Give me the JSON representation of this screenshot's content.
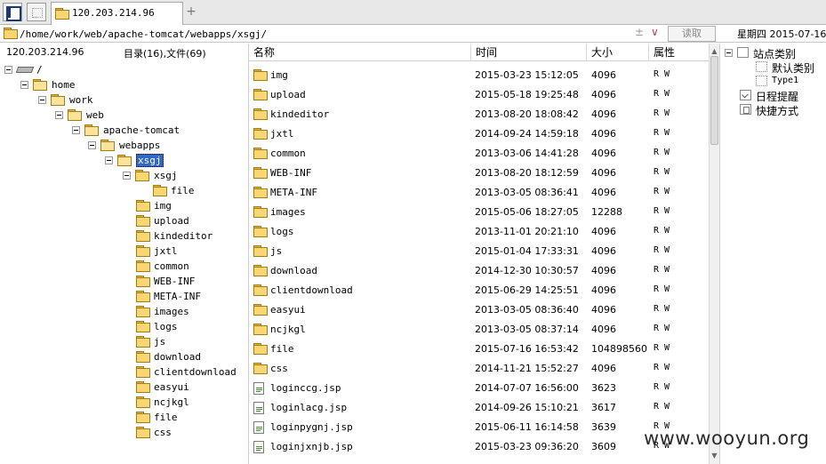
{
  "tab": {
    "title": "120.203.214.96",
    "add_label": "+"
  },
  "address": {
    "path": "/home/work/web/apache-tomcat/webapps/xsgj/",
    "plus_symbol": "±",
    "dropdown_symbol": "∨",
    "read_label": "读取",
    "date_text": "星期四 2015-07-16"
  },
  "left": {
    "ip": "120.203.214.96",
    "count": "目录(16),文件(69)",
    "tree": [
      {
        "label": "/",
        "icon": "drive-icon"
      },
      {
        "label": "home"
      },
      {
        "label": "work"
      },
      {
        "label": "web"
      },
      {
        "label": "apache-tomcat"
      },
      {
        "label": "webapps"
      },
      {
        "label": "xsgj",
        "selected": true
      },
      {
        "label": "xsgj"
      },
      {
        "label": "file"
      },
      {
        "label": "img"
      },
      {
        "label": "upload"
      },
      {
        "label": "kindeditor"
      },
      {
        "label": "jxtl"
      },
      {
        "label": "common"
      },
      {
        "label": "WEB-INF"
      },
      {
        "label": "META-INF"
      },
      {
        "label": "images"
      },
      {
        "label": "logs"
      },
      {
        "label": "js"
      },
      {
        "label": "download"
      },
      {
        "label": "clientdownload"
      },
      {
        "label": "easyui"
      },
      {
        "label": "ncjkgl"
      },
      {
        "label": "file"
      },
      {
        "label": "css"
      }
    ]
  },
  "list": {
    "columns": {
      "name": "名称",
      "time": "时间",
      "size": "大小",
      "attr": "属性"
    },
    "rows": [
      {
        "name": "img",
        "time": "2015-03-23 15:12:05",
        "size": "4096",
        "attr": "R W",
        "type": "folder"
      },
      {
        "name": "upload",
        "time": "2015-05-18 19:25:48",
        "size": "4096",
        "attr": "R W",
        "type": "folder"
      },
      {
        "name": "kindeditor",
        "time": "2013-08-20 18:08:42",
        "size": "4096",
        "attr": "R W",
        "type": "folder"
      },
      {
        "name": "jxtl",
        "time": "2014-09-24 14:59:18",
        "size": "4096",
        "attr": "R W",
        "type": "folder"
      },
      {
        "name": "common",
        "time": "2013-03-06 14:41:28",
        "size": "4096",
        "attr": "R W",
        "type": "folder"
      },
      {
        "name": "WEB-INF",
        "time": "2013-08-20 18:12:59",
        "size": "4096",
        "attr": "R W",
        "type": "folder"
      },
      {
        "name": "META-INF",
        "time": "2013-03-05 08:36:41",
        "size": "4096",
        "attr": "R W",
        "type": "folder"
      },
      {
        "name": "images",
        "time": "2015-05-06 18:27:05",
        "size": "12288",
        "attr": "R W",
        "type": "folder"
      },
      {
        "name": "logs",
        "time": "2013-11-01 20:21:10",
        "size": "4096",
        "attr": "R W",
        "type": "folder"
      },
      {
        "name": "js",
        "time": "2015-01-04 17:33:31",
        "size": "4096",
        "attr": "R W",
        "type": "folder"
      },
      {
        "name": "download",
        "time": "2014-12-30 10:30:57",
        "size": "4096",
        "attr": "R W",
        "type": "folder"
      },
      {
        "name": "clientdownload",
        "time": "2015-06-29 14:25:51",
        "size": "4096",
        "attr": "R W",
        "type": "folder"
      },
      {
        "name": "easyui",
        "time": "2013-03-05 08:36:40",
        "size": "4096",
        "attr": "R W",
        "type": "folder"
      },
      {
        "name": "ncjkgl",
        "time": "2013-03-05 08:37:14",
        "size": "4096",
        "attr": "R W",
        "type": "folder"
      },
      {
        "name": "file",
        "time": "2015-07-16 16:53:42",
        "size": "104898560",
        "attr": "R W",
        "type": "folder"
      },
      {
        "name": "css",
        "time": "2014-11-21 15:52:27",
        "size": "4096",
        "attr": "R W",
        "type": "folder"
      },
      {
        "name": "loginccg.jsp",
        "time": "2014-07-07 16:56:00",
        "size": "3623",
        "attr": "R W",
        "type": "file"
      },
      {
        "name": "loginlacg.jsp",
        "time": "2014-09-26 15:10:21",
        "size": "3617",
        "attr": "R W",
        "type": "file"
      },
      {
        "name": "loginpygnj.jsp",
        "time": "2015-06-11 16:14:58",
        "size": "3639",
        "attr": "R W",
        "type": "file"
      },
      {
        "name": "loginjxnjb.jsp",
        "time": "2015-03-23 09:36:20",
        "size": "3609",
        "attr": "R W",
        "type": "file"
      }
    ]
  },
  "right": {
    "items": [
      {
        "label": "站点类别"
      },
      {
        "label": "默认类别"
      },
      {
        "label": "Type1"
      },
      {
        "label": "日程提醒"
      },
      {
        "label": "快捷方式"
      }
    ]
  },
  "watermark": "www.wooyun.org",
  "colors": {
    "selection": "#3168c6",
    "folder": "#f8d772",
    "accent": "#1b3a72"
  }
}
